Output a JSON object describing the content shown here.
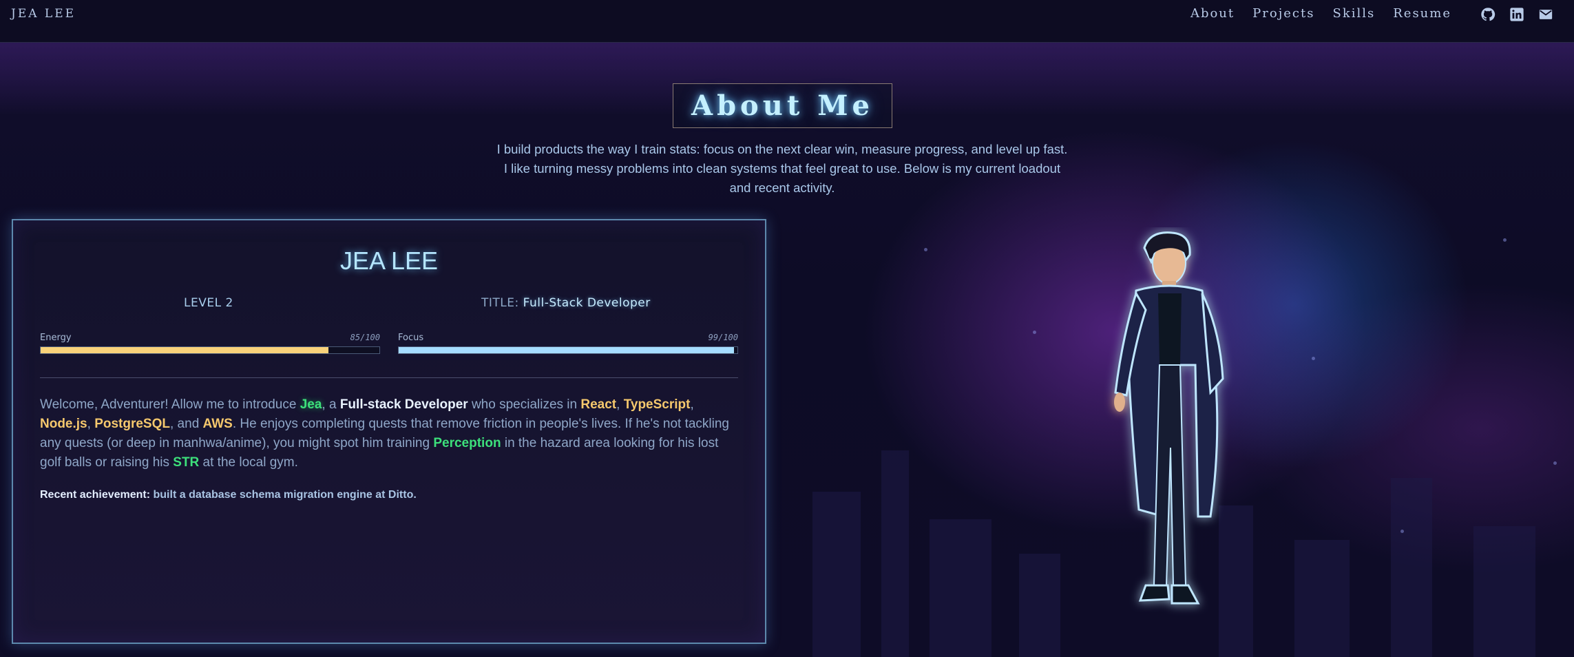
{
  "header": {
    "brand": "JEA LEE",
    "nav": [
      "About",
      "Projects",
      "Skills",
      "Resume"
    ],
    "icons": [
      "github-icon",
      "linkedin-icon",
      "mail-icon"
    ]
  },
  "about": {
    "title": "About Me",
    "intro": "I build products the way I train stats: focus on the next clear win, measure progress, and level up fast. I like turning messy problems into clean systems that feel great to use. Below is my current loadout and recent activity."
  },
  "card": {
    "name": "JEA LEE",
    "level": "LEVEL 2",
    "title_label": "TITLE:",
    "title_value": "Full-Stack Developer",
    "bars": {
      "energy": {
        "label": "Energy",
        "value_text": "85/100",
        "value": 85,
        "color": "#f9d27a"
      },
      "focus": {
        "label": "Focus",
        "value_text": "99/100",
        "value": 99,
        "color": "#a6ddff"
      }
    },
    "bio": {
      "p1": "Welcome, Adventurer! Allow me to introduce ",
      "name": "Jea",
      "p2": ", a ",
      "role": "Full-stack Developer",
      "p3": " who specializes in ",
      "s1": "React",
      "c1": ", ",
      "s2": "TypeScript",
      "c2": ", ",
      "s3": "Node.js",
      "c3": ", ",
      "s4": "PostgreSQL",
      "c4": ", and ",
      "s5": "AWS",
      "p4": ". He enjoys completing quests that remove friction in people's lives. If he's not tackling any quests (or deep in manhwa/anime), you might spot him training ",
      "stat1": "Perception",
      "p5": " in the hazard area looking for his lost golf balls or raising his ",
      "stat2": "STR",
      "p6": " at the local gym."
    },
    "achievement_label": "Recent achievement:",
    "achievement_text": " built a database schema migration engine at Ditto."
  },
  "colors": {
    "accent_cyan": "#a6ddff",
    "energy_yellow": "#f9d27a",
    "highlight_green": "#3de07b",
    "highlight_yellow": "#f5c86d",
    "background": "#0c0b22"
  }
}
